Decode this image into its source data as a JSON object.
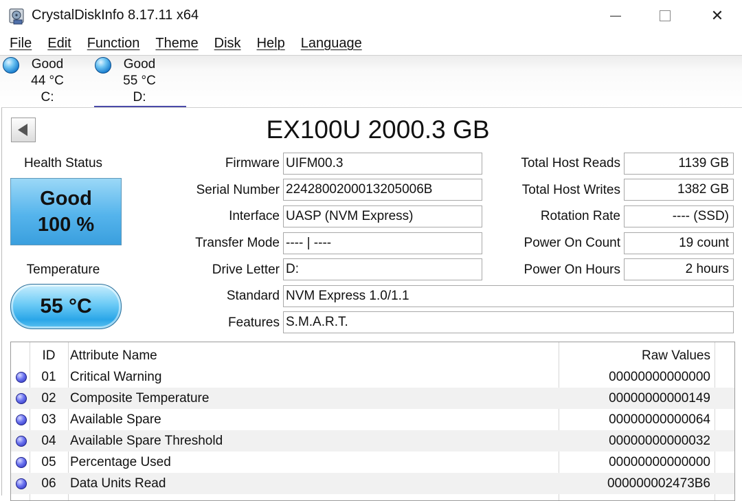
{
  "window": {
    "title": "CrystalDiskInfo 8.17.11 x64"
  },
  "menu": [
    "File",
    "Edit",
    "Function",
    "Theme",
    "Disk",
    "Help",
    "Language"
  ],
  "disks": [
    {
      "status": "Good",
      "temp": "44 °C",
      "letter": "C:",
      "color": "#1c7fcf"
    },
    {
      "status": "Good",
      "temp": "55 °C",
      "letter": "D:",
      "color": "#1c7fcf",
      "selected": true
    }
  ],
  "disk_title": "EX100U 2000.3 GB",
  "health": {
    "label": "Health Status",
    "status": "Good",
    "percent": "100 %"
  },
  "temperature": {
    "label": "Temperature",
    "value": "55 °C"
  },
  "info": {
    "firmware": {
      "label": "Firmware",
      "value": "UIFM00.3"
    },
    "serial": {
      "label": "Serial Number",
      "value": "2242800200013205006B"
    },
    "interface": {
      "label": "Interface",
      "value": "UASP (NVM Express)"
    },
    "transfer": {
      "label": "Transfer Mode",
      "value": "---- | ----"
    },
    "drive_letter": {
      "label": "Drive Letter",
      "value": "D:"
    },
    "standard": {
      "label": "Standard",
      "value": "NVM Express 1.0/1.1"
    },
    "features": {
      "label": "Features",
      "value": "S.M.A.R.T."
    },
    "host_reads": {
      "label": "Total Host Reads",
      "value": "1139 GB"
    },
    "host_writes": {
      "label": "Total Host Writes",
      "value": "1382 GB"
    },
    "rotation": {
      "label": "Rotation Rate",
      "value": "---- (SSD)"
    },
    "power_count": {
      "label": "Power On Count",
      "value": "19 count"
    },
    "power_hours": {
      "label": "Power On Hours",
      "value": "2 hours"
    }
  },
  "smart": {
    "headers": {
      "id": "ID",
      "name": "Attribute Name",
      "raw": "Raw Values"
    },
    "rows": [
      {
        "id": "01",
        "name": "Critical Warning",
        "raw": "00000000000000"
      },
      {
        "id": "02",
        "name": "Composite Temperature",
        "raw": "00000000000149"
      },
      {
        "id": "03",
        "name": "Available Spare",
        "raw": "00000000000064"
      },
      {
        "id": "04",
        "name": "Available Spare Threshold",
        "raw": "00000000000032"
      },
      {
        "id": "05",
        "name": "Percentage Used",
        "raw": "00000000000000"
      },
      {
        "id": "06",
        "name": "Data Units Read",
        "raw": "000000002473B6"
      }
    ]
  },
  "colors": {
    "health_blue": "#55b4ec",
    "status_dot": "#2a2fb8",
    "tab_underline": "#4a4aa8"
  }
}
